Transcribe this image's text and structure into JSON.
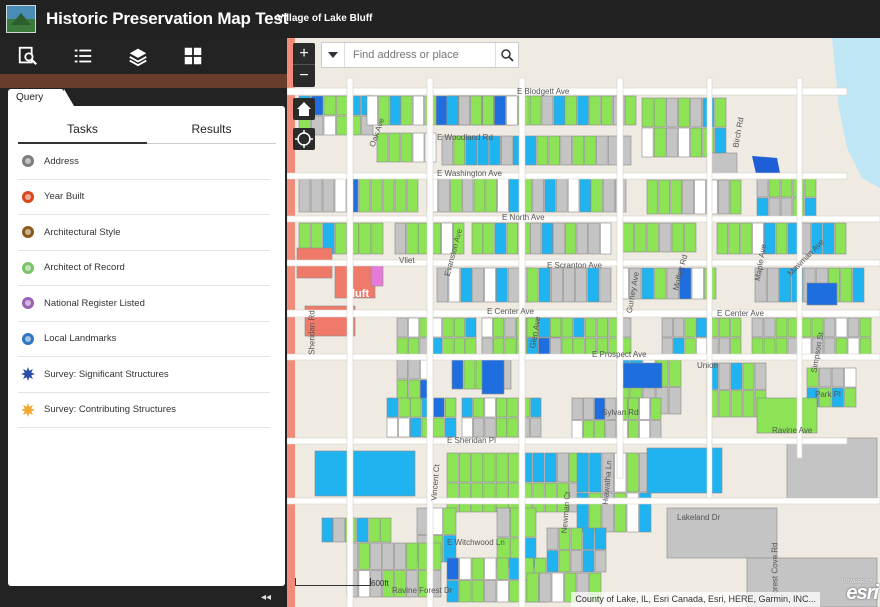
{
  "header": {
    "title": "Historic Preservation Map Test",
    "subtitle": "Village of Lake Bluff"
  },
  "toolbar": {
    "buttons": [
      "query-icon",
      "list-icon",
      "layers-icon",
      "grid-icon"
    ]
  },
  "panel": {
    "tab_label": "Query",
    "tabs": [
      "Tasks",
      "Results"
    ],
    "tasks": [
      {
        "label": "Address",
        "icon": "circle-icon",
        "color": "#7d7d7d"
      },
      {
        "label": "Year Built",
        "icon": "circle-icon",
        "color": "#d9481c"
      },
      {
        "label": "Architectural Style",
        "icon": "circle-icon",
        "color": "#8a5a1a"
      },
      {
        "label": "Architect of Record",
        "icon": "circle-icon",
        "color": "#7cc46b"
      },
      {
        "label": "National Register Listed",
        "icon": "circle-icon",
        "color": "#9b5fb5"
      },
      {
        "label": "Local Landmarks",
        "icon": "circle-icon",
        "color": "#2e78c2"
      },
      {
        "label": "Survey: Significant Structures",
        "icon": "star-icon",
        "color": "#2b4fa8"
      },
      {
        "label": "Survey: Contributing Structures",
        "icon": "star-icon",
        "color": "#f0a830"
      }
    ],
    "collapse": "◂◂"
  },
  "map": {
    "search": {
      "placeholder": "Find address or place"
    },
    "zoom_in": "+",
    "zoom_out": "−",
    "scale_label": "600ft",
    "attribution": "County of Lake, IL, Esri Canada, Esri, HERE, Garmin, INC...",
    "esri": "esri",
    "powered_by": "POWERED BY",
    "roads": [
      "E Blodgett Ave",
      "E Woodland Rd",
      "E Washington Ave",
      "E North Ave",
      "E Scranton Ave",
      "E Center Ave",
      "E Center Ave",
      "E Prospect Ave",
      "Sylvan Rd",
      "E Sheridan Pl",
      "Ravine Ave",
      "Park Pl",
      "E Witchwood Ln",
      "Ravine Forest Dr",
      "Lakeland Dr",
      "Forest Cove Rd",
      "Oak Ave",
      "Evanston Ave",
      "Glen Ave",
      "Gurney Ave",
      "Maple Ave",
      "Simpson St",
      "Birch Rd",
      "Mawman Ave",
      "Moffett Rd",
      "Vliet",
      "Sheridan Rd",
      "Newman Ct",
      "Hiawatha Ln",
      "Vincent Ct",
      "Union",
      "luft"
    ],
    "colors": {
      "green": "#8ce356",
      "blue": "#1fb3f0",
      "darkblue": "#1f6ee0",
      "gray": "#c4c4c4",
      "salmon": "#f07a6a",
      "pink": "#e67ad8",
      "water": "#bfe6f5",
      "lakeblue": "#1e5fd8"
    }
  }
}
